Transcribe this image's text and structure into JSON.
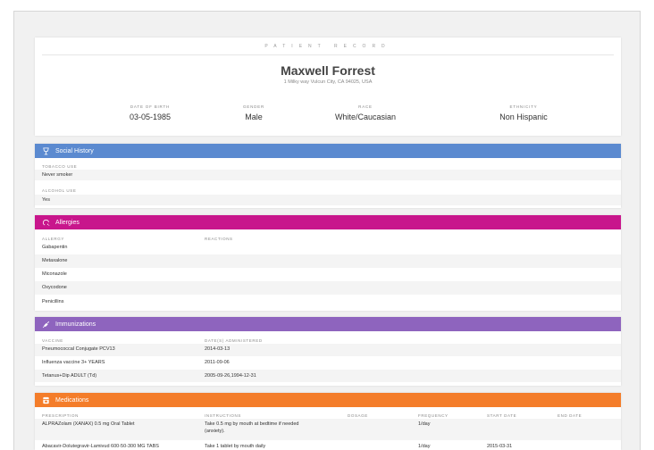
{
  "patient": {
    "eyebrow": "PATIENT RECORD",
    "name": "Maxwell Forrest",
    "address": "1 Milky way Vulcun City, CA 94025, USA",
    "demographics": [
      {
        "label": "DATE OF BIRTH",
        "value": "03-05-1985"
      },
      {
        "label": "GENDER",
        "value": "Male"
      },
      {
        "label": "RACE",
        "value": "White/Caucasian"
      },
      {
        "label": "ETHNICITY",
        "value": "Non Hispanic"
      }
    ]
  },
  "colors": {
    "social": "#5b8ad0",
    "allergies": "#c8168c",
    "immunizations": "#8e64be",
    "medications": "#f47d2a"
  },
  "social": {
    "title": "Social History",
    "icon": "wine-glass-icon",
    "tobacco_label": "TOBACCO USE",
    "tobacco_value": "Never smoker",
    "alcohol_label": "ALCOHOL USE",
    "alcohol_value": "Yes"
  },
  "allergies": {
    "title": "Allergies",
    "icon": "allergy-icon",
    "col_allergy": "ALLERGY",
    "col_reactions": "REACTIONS",
    "items": [
      "Gabapentin",
      "Metaxalone",
      "Miconazole",
      "Oxycodone",
      "Penicillins"
    ]
  },
  "immunizations": {
    "title": "Immunizations",
    "icon": "syringe-icon",
    "col_vaccine": "VACCINE",
    "col_dates": "DATE(S) ADMINISTERED",
    "rows": [
      {
        "vaccine": "Pneumococcal Conjugate PCV13",
        "dates": "2014-03-13"
      },
      {
        "vaccine": "Influenza vaccine 3+ YEARS",
        "dates": "2011-09-06"
      },
      {
        "vaccine": "Tetanus+Dip ADULT (Td)",
        "dates": "2005-09-26,1994-12-31"
      }
    ]
  },
  "medications": {
    "title": "Medications",
    "icon": "pill-box-icon",
    "cols": {
      "prescription": "PRESCRIPTION",
      "instructions": "INSTRUCTIONS",
      "dosage": "DOSAGE",
      "frequency": "FREQUENCY",
      "start": "START DATE",
      "end": "END DATE"
    },
    "rows": [
      {
        "prescription": "ALPRAZolam (XANAX) 0.5 mg Oral Tablet",
        "instructions_1": "Take 0.5 mg by mouth at bedtime if needed",
        "instructions_2": "(anxiety).",
        "frequency": "1/day",
        "start": ""
      },
      {
        "prescription": "Abacavir-Dolutegravir-Lamivud 600-50-300 MG TABS",
        "instructions_1": "Take 1 tablet by mouth daily",
        "instructions_2": "",
        "frequency": "1/day",
        "start": "2015-03-31"
      }
    ]
  }
}
